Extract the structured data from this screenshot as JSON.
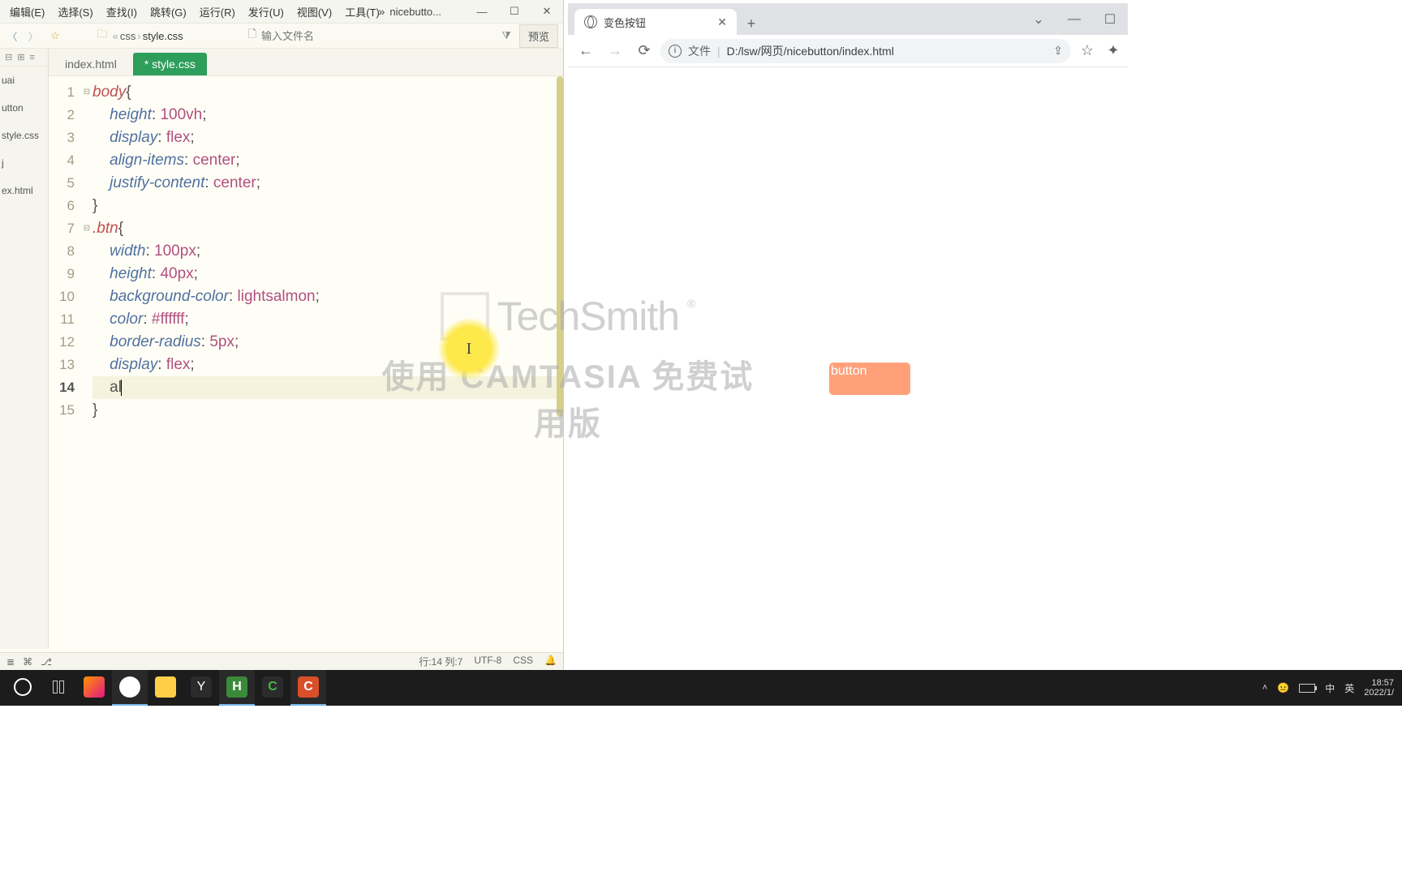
{
  "editor": {
    "menu": [
      "编辑(E)",
      "选择(S)",
      "查找(I)",
      "跳转(G)",
      "运行(R)",
      "发行(U)",
      "视图(V)",
      "工具(T)"
    ],
    "title_tab": "nicebutto...",
    "breadcrumb": {
      "icon": "folder",
      "crumb1": "css",
      "crumb2": "style.css"
    },
    "newfile_placeholder": "输入文件名",
    "preview_btn": "预览",
    "tabs": [
      {
        "label": "index.html",
        "active": false
      },
      {
        "label": "* style.css",
        "active": true
      }
    ],
    "sidebar_files": [
      "uai",
      "utton",
      "style.css",
      "j",
      "ex.html"
    ],
    "code_lines": [
      {
        "n": 1,
        "fold": "⊟",
        "html": "<span class='tok-tag'>body</span><span class='tok-punc'>{</span>"
      },
      {
        "n": 2,
        "html": "    <span class='tok-prop'>height</span><span class='tok-punc'>: </span><span class='tok-num'>100vh</span><span class='tok-punc'>;</span>"
      },
      {
        "n": 3,
        "html": "    <span class='tok-prop'>display</span><span class='tok-punc'>: </span><span class='tok-val'>flex</span><span class='tok-punc'>;</span>"
      },
      {
        "n": 4,
        "html": "    <span class='tok-prop'>align-items</span><span class='tok-punc'>: </span><span class='tok-val'>center</span><span class='tok-punc'>;</span>"
      },
      {
        "n": 5,
        "html": "    <span class='tok-prop'>justify-content</span><span class='tok-punc'>: </span><span class='tok-val'>center</span><span class='tok-punc'>;</span>"
      },
      {
        "n": 6,
        "html": "<span class='tok-punc'>}</span>"
      },
      {
        "n": 7,
        "fold": "⊟",
        "html": "<span class='tok-sel'>.btn</span><span class='tok-punc'>{</span>"
      },
      {
        "n": 8,
        "html": "    <span class='tok-prop'>width</span><span class='tok-punc'>: </span><span class='tok-num'>100px</span><span class='tok-punc'>;</span>"
      },
      {
        "n": 9,
        "html": "    <span class='tok-prop'>height</span><span class='tok-punc'>: </span><span class='tok-num'>40px</span><span class='tok-punc'>;</span>"
      },
      {
        "n": 10,
        "html": "    <span class='tok-prop'>background-color</span><span class='tok-punc'>: </span><span class='tok-val'>lightsalmon</span><span class='tok-punc'>;</span>"
      },
      {
        "n": 11,
        "html": "    <span class='tok-prop'>color</span><span class='tok-punc'>: </span><span class='tok-hex'>#ffffff</span><span class='tok-punc'>;</span>"
      },
      {
        "n": 12,
        "html": "    <span class='tok-prop'>border-radius</span><span class='tok-punc'>: </span><span class='tok-num'>5px</span><span class='tok-punc'>;</span>"
      },
      {
        "n": 13,
        "html": "    <span class='tok-prop'>display</span><span class='tok-punc'>: </span><span class='tok-val'>flex</span><span class='tok-punc'>;</span>"
      },
      {
        "n": 14,
        "cur": true,
        "html": "    <span class='tok-punc'>al</span><span class='caret'></span>"
      },
      {
        "n": 15,
        "html": "<span class='tok-punc'>}</span>"
      }
    ],
    "status": {
      "pos": "行:14 列:7",
      "enc": "UTF-8",
      "lang": "CSS",
      "bell": "🔔"
    }
  },
  "browser": {
    "tab_title": "变色按钮",
    "addr_label": "文件",
    "url": "D:/lsw/网页/nicebutton/index.html",
    "button_text": "button"
  },
  "watermark": {
    "brand": "TechSmith",
    "sub": "使用 CAMTASIA 免费试用版"
  },
  "taskbar": {
    "tray": {
      "ime1": "中",
      "ime2": "英",
      "time": "18:57",
      "date": "2022/1/"
    }
  }
}
